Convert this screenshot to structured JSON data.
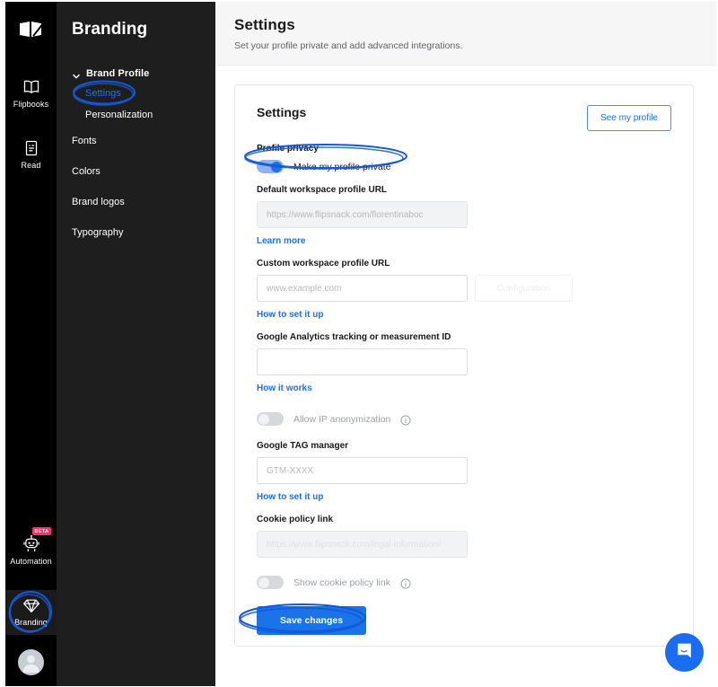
{
  "rail": {
    "logo_icon": "flipsnack-book-logo-icon",
    "items": [
      {
        "label": "Flipbooks",
        "icon": "open-book-icon",
        "badge": null,
        "active": false
      },
      {
        "label": "Read",
        "icon": "document-read-icon",
        "badge": null,
        "active": false
      }
    ],
    "bottom_items": [
      {
        "label": "Automation",
        "icon": "robot-icon",
        "badge": "BETA",
        "active": false
      },
      {
        "label": "Branding",
        "icon": "diamond-icon",
        "badge": null,
        "active": true
      }
    ],
    "avatar": "user-avatar"
  },
  "sidebar": {
    "title": "Branding",
    "group": {
      "label": "Brand Profile",
      "expanded": true,
      "children": [
        {
          "label": "Settings",
          "selected": true
        },
        {
          "label": "Personalization",
          "selected": false
        }
      ]
    },
    "items": [
      {
        "label": "Fonts"
      },
      {
        "label": "Colors"
      },
      {
        "label": "Brand logos"
      },
      {
        "label": "Typography"
      }
    ]
  },
  "header": {
    "title": "Settings",
    "subtitle": "Set your profile private and add advanced integrations."
  },
  "card": {
    "title": "Settings",
    "see_profile_label": "See my profile",
    "profile_privacy": {
      "label": "Profile privacy",
      "toggle_label": "Make my profile private",
      "toggle_on": true
    },
    "default_url": {
      "label": "Default workspace profile URL",
      "value": "",
      "placeholder": "https://www.flipsnack.com/florentinaboc",
      "link": "Learn more"
    },
    "custom_url": {
      "label": "Custom workspace profile URL",
      "value": "",
      "placeholder": "www.example.com",
      "config_button": "Configuration",
      "link": "How to set it up"
    },
    "analytics": {
      "label": "Google Analytics tracking or measurement ID",
      "value": "",
      "placeholder": "",
      "link": "How it works"
    },
    "ip_anonymization": {
      "toggle_label": "Allow IP anonymization",
      "toggle_on": false,
      "info_icon": "info-circle-icon"
    },
    "tag_manager": {
      "label": "Google TAG manager",
      "value": "",
      "placeholder": "GTM-XXXX",
      "link": "How to set it up"
    },
    "cookie_policy": {
      "label": "Cookie policy link",
      "value": "",
      "placeholder": "https://www.flipsnack.com/legal-information/",
      "toggle_label": "Show cookie policy link",
      "toggle_on": false,
      "info_icon": "info-circle-icon"
    },
    "save_label": "Save changes"
  },
  "chat": {
    "icon": "chat-bubble-icon"
  },
  "colors": {
    "accent": "#1a73e8",
    "rail_bg": "#000000",
    "subnav_bg": "#1e1e1e",
    "header_bg": "#f6f6f6",
    "beta_badge": "#f4356b",
    "annotation": "#1558d6"
  }
}
